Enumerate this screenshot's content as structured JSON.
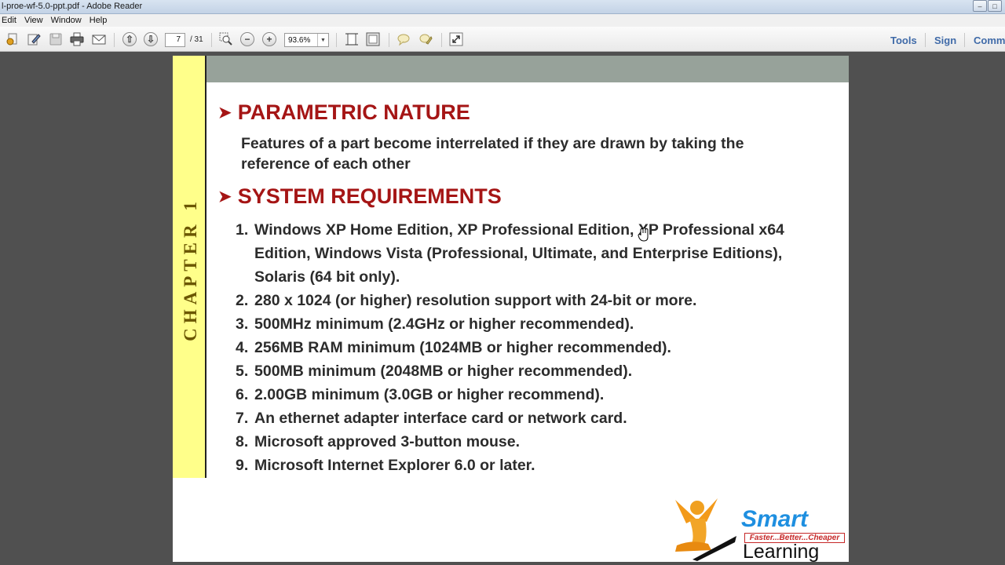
{
  "window": {
    "title": "l-proe-wf-5.0-ppt.pdf - Adobe Reader",
    "controls": [
      "–",
      "□"
    ]
  },
  "menu": [
    "Edit",
    "View",
    "Window",
    "Help"
  ],
  "toolbar": {
    "page_current": "7",
    "page_total": "/ 31",
    "zoom": "93.6%",
    "links": [
      "Tools",
      "Sign",
      "Comm"
    ]
  },
  "document": {
    "chapter_label": "CHAPTER 1",
    "section1": {
      "heading": "PARAMETRIC NATURE",
      "text": "Features of a part become interrelated if they are drawn by taking the reference of each other"
    },
    "section2": {
      "heading": "SYSTEM REQUIREMENTS",
      "items": [
        {
          "num": "1.",
          "text": "Windows XP Home Edition, XP Professional Edition, XP Professional x64 Edition, Windows Vista (Professional, Ultimate, and Enterprise Editions), Solaris (64 bit only)."
        },
        {
          "num": "2.",
          "text": "280 x 1024 (or higher) resolution support with 24-bit or more."
        },
        {
          "num": "3.",
          "text": "500MHz minimum (2.4GHz or higher recommended)."
        },
        {
          "num": "4.",
          "text": "256MB RAM minimum (1024MB or higher recommended)."
        },
        {
          "num": "5.",
          "text": "500MB minimum (2048MB or higher recommended)."
        },
        {
          "num": "6.",
          "text": "2.00GB minimum (3.0GB or higher recommend)."
        },
        {
          "num": "7.",
          "text": "An ethernet adapter interface card or network card."
        },
        {
          "num": "8.",
          "text": "Microsoft approved 3-button mouse."
        },
        {
          "num": "9.",
          "text": "Microsoft Internet Explorer 6.0 or later."
        }
      ]
    },
    "logo": {
      "brand": "Smart",
      "tagline": "Faster...Better...Cheaper",
      "word": "Learning"
    }
  },
  "colors": {
    "heading": "#a51515",
    "chapter_bar": "#ffff8a",
    "header_band": "#97a29a",
    "brand_blue": "#1e8fe0"
  }
}
